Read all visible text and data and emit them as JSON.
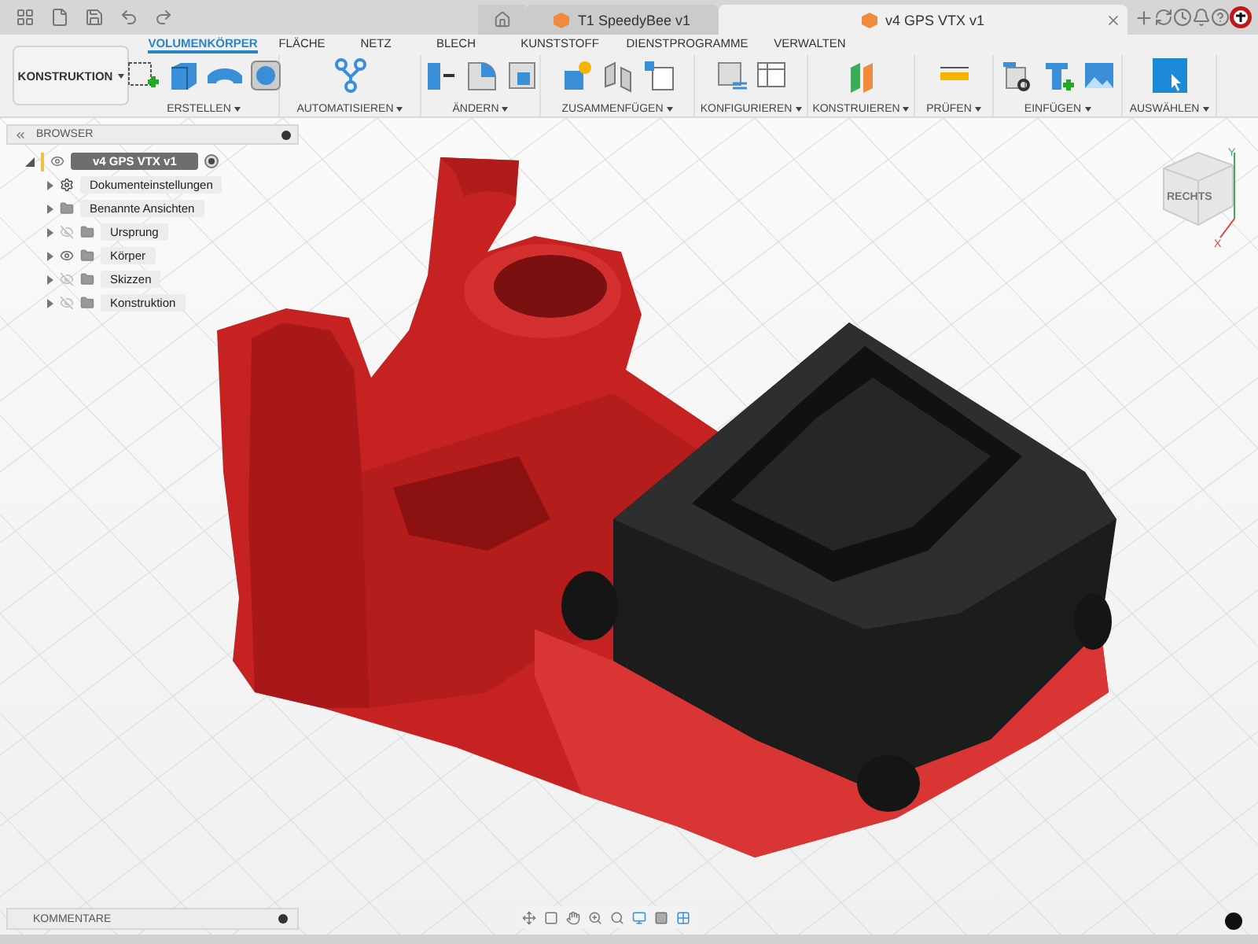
{
  "title_bar": {
    "tabs": [
      {
        "title": "T1 SpeedyBee v1",
        "selected": false
      },
      {
        "title": "v4 GPS VTX v1",
        "selected": true
      }
    ]
  },
  "ribbon": {
    "workspace": "KONSTRUKTION",
    "tabs": [
      {
        "label": "VOLUMENKÖRPER",
        "selected": true
      },
      {
        "label": "FLÄCHE",
        "selected": false
      },
      {
        "label": "NETZ",
        "selected": false
      },
      {
        "label": "BLECH",
        "selected": false
      },
      {
        "label": "KUNSTSTOFF",
        "selected": false
      },
      {
        "label": "DIENSTPROGRAMME",
        "selected": false
      },
      {
        "label": "VERWALTEN",
        "selected": false
      }
    ],
    "groups": [
      {
        "label": "ERSTELLEN"
      },
      {
        "label": "AUTOMATISIEREN"
      },
      {
        "label": "ÄNDERN"
      },
      {
        "label": "ZUSAMMENFÜGEN"
      },
      {
        "label": "KONFIGURIEREN"
      },
      {
        "label": "KONSTRUIEREN"
      },
      {
        "label": "PRÜFEN"
      },
      {
        "label": "EINFÜGEN"
      },
      {
        "label": "AUSWÄHLEN"
      }
    ]
  },
  "browser": {
    "title": "BROWSER",
    "root": {
      "label": "v4 GPS VTX v1"
    },
    "items": [
      {
        "label": "Dokumenteinstellungen",
        "kind": "settings"
      },
      {
        "label": "Benannte Ansichten",
        "kind": "folder"
      },
      {
        "label": "Ursprung",
        "kind": "layer",
        "visible": false
      },
      {
        "label": "Körper",
        "kind": "layer",
        "visible": true
      },
      {
        "label": "Skizzen",
        "kind": "layer",
        "visible": false
      },
      {
        "label": "Konstruktion",
        "kind": "layer",
        "visible": false
      }
    ]
  },
  "view_cube": {
    "face": "RECHTS",
    "axis_y": "Y",
    "axis_x": "X"
  },
  "comments": {
    "title": "KOMMENTARE"
  }
}
